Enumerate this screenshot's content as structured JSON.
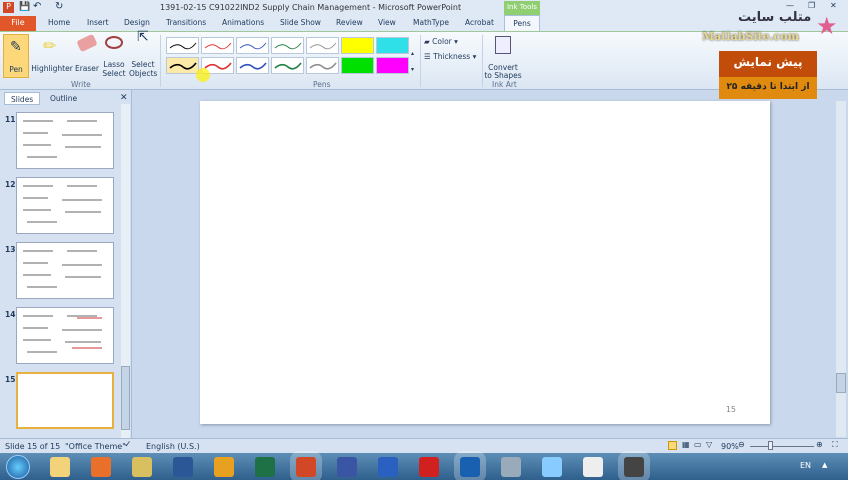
{
  "window": {
    "title": "1391-02-15 C91022IND2 Supply Chain Management  -  Microsoft PowerPoint"
  },
  "tabs": [
    "File",
    "Home",
    "Insert",
    "Design",
    "Transitions",
    "Animations",
    "Slide Show",
    "Review",
    "View",
    "MathType",
    "Acrobat"
  ],
  "contextual": {
    "group": "Ink Tools",
    "tab": "Pens"
  },
  "ribbon": {
    "write": {
      "label": "Write",
      "buttons": [
        "Pen",
        "Highlighter",
        "Eraser",
        "Lasso Select",
        "Select Objects"
      ]
    },
    "pens": {
      "label": "Pens",
      "colors_row1": [
        "#000000",
        "#e03030",
        "#3050c0",
        "#208040",
        "#909090",
        "#ffff00",
        "#30e0e8"
      ],
      "colors_row2": [
        "#000000",
        "#e03030",
        "#3050c0",
        "#208040",
        "#909090",
        "#00e000",
        "#ff00ff"
      ]
    },
    "color": "Color",
    "thickness": "Thickness",
    "inkart": {
      "label": "Ink Art",
      "convert": "Convert to Shapes"
    }
  },
  "watermark": {
    "logo_fa": "متلب سایت",
    "logo_en": "MatlabSite.com",
    "preview_title": "پیش نمایش",
    "preview_sub": "از ابتدا تا دقیقه ۲۵"
  },
  "panel": {
    "tabs": [
      "Slides",
      "Outline"
    ],
    "slides": [
      "11",
      "12",
      "13",
      "14",
      "15"
    ],
    "selected": "15"
  },
  "slide": {
    "number": "15"
  },
  "status": {
    "slide": "Slide 15 of 15",
    "theme": "\"Office Theme\"",
    "language": "English (U.S.)",
    "zoom": "90%"
  },
  "taskbar": {
    "lang": "EN",
    "apps": [
      "windows-explorer",
      "firefox",
      "editor",
      "word",
      "outlook",
      "excel",
      "powerpoint",
      "visio",
      "app",
      "app2",
      "matlab",
      "calculator",
      "notepad",
      "paint",
      "camera"
    ]
  }
}
